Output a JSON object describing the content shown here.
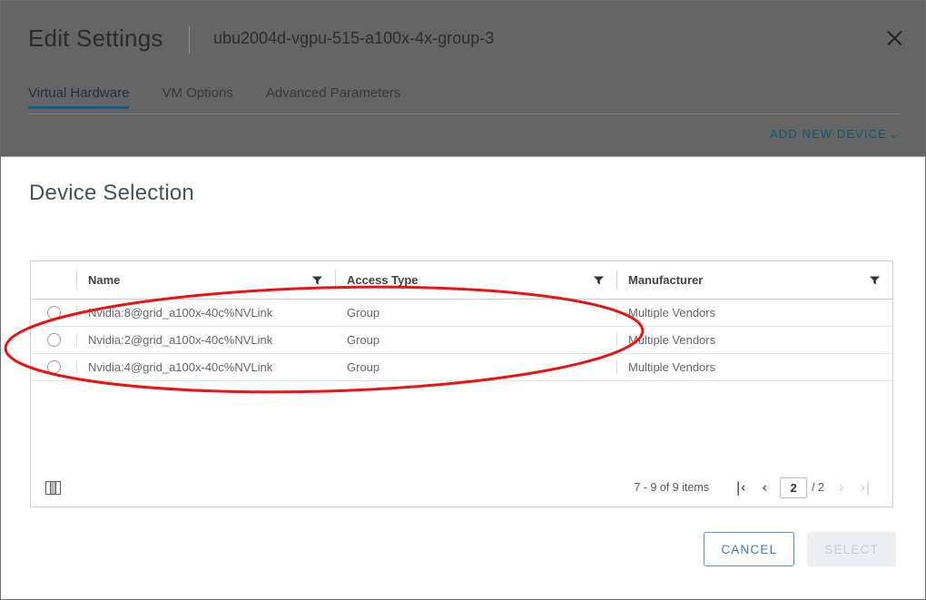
{
  "dialog": {
    "title": "Edit Settings",
    "subtitle": "ubu2004d-vgpu-515-a100x-4x-group-3",
    "close_icon": "close-icon"
  },
  "tabs": [
    {
      "label": "Virtual Hardware",
      "active": true
    },
    {
      "label": "VM Options",
      "active": false
    },
    {
      "label": "Advanced Parameters",
      "active": false
    }
  ],
  "toolbar": {
    "add_new_device_label": "ADD NEW DEVICE",
    "add_new_device_chevron": "⌄"
  },
  "modal": {
    "title": "Device Selection",
    "grid": {
      "columns": [
        {
          "key": "radio",
          "label": ""
        },
        {
          "key": "name",
          "label": "Name",
          "filter_icon": "filter-icon"
        },
        {
          "key": "access_type",
          "label": "Access Type",
          "filter_icon": "filter-icon"
        },
        {
          "key": "manufacturer",
          "label": "Manufacturer",
          "filter_icon": "filter-icon"
        }
      ],
      "rows": [
        {
          "name": "Nvidia:8@grid_a100x-40c%NVLink",
          "access_type": "Group",
          "manufacturer": "Multiple Vendors",
          "selected": false
        },
        {
          "name": "Nvidia:2@grid_a100x-40c%NVLink",
          "access_type": "Group",
          "manufacturer": "Multiple Vendors",
          "selected": false
        },
        {
          "name": "Nvidia:4@grid_a100x-40c%NVLink",
          "access_type": "Group",
          "manufacturer": "Multiple Vendors",
          "selected": false
        }
      ],
      "footer": {
        "column_settings_icon": "columns-icon",
        "item_range": "7 - 9 of 9 items",
        "first_page_icon": "|‹",
        "prev_page_icon": "‹",
        "current_page": "2",
        "total_pages": "/ 2",
        "next_page_icon": "›",
        "last_page_icon": "›|"
      }
    },
    "actions": {
      "cancel_label": "CANCEL",
      "select_label": "SELECT"
    }
  },
  "annotation": {
    "shape": "ellipse",
    "color": "#ee1111",
    "stroke_width": 3
  },
  "colors": {
    "backdrop": "#656565",
    "accent_blue": "#0f5c8c",
    "link_blue": "#0c5676",
    "annotation_red": "#ee1111"
  }
}
